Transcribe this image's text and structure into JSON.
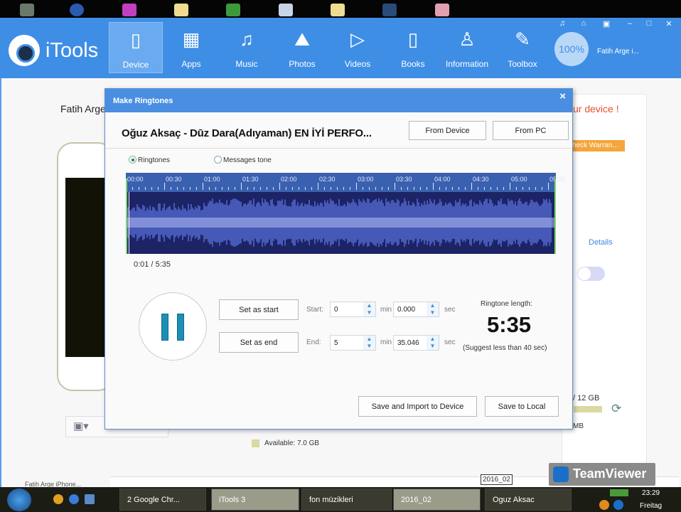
{
  "header": {
    "app_name": "iTools",
    "battery": "100%",
    "user": "Fatih Arge i...",
    "nav": [
      {
        "label": "Device",
        "icon": "phone-icon"
      },
      {
        "label": "Apps",
        "icon": "apps-icon"
      },
      {
        "label": "Music",
        "icon": "music-icon"
      },
      {
        "label": "Photos",
        "icon": "photo-icon"
      },
      {
        "label": "Videos",
        "icon": "video-icon"
      },
      {
        "label": "Books",
        "icon": "book-icon"
      },
      {
        "label": "Information",
        "icon": "user-icon"
      },
      {
        "label": "Toolbox",
        "icon": "wrench-icon"
      }
    ]
  },
  "background": {
    "device_name": "Fatih Arge",
    "alert": "ur device !",
    "warranty": "heck  Warran...",
    "details": "Details",
    "storage": "/ 12 GB",
    "mb": "MB",
    "available": "Available: 7.0 GB",
    "status_device": "Fatih Arge iPhone..."
  },
  "dialog": {
    "title": "Make Ringtones",
    "close": "×",
    "song": "Oğuz Aksaç - Dūz Dara(Adıyaman) EN İYİ PERFO...",
    "from_device": "From Device",
    "from_pc": "From PC",
    "radio_ringtones": "Ringtones",
    "radio_messages": "Messages tone",
    "time_labels": [
      "00:00",
      "00:30",
      "01:00",
      "01:30",
      "02:00",
      "02:30",
      "03:00",
      "03:30",
      "04:00",
      "04:30",
      "05:00",
      "05:30"
    ],
    "position": "0:01 / 5:35",
    "playback_progress": 0.003,
    "set_start": "Set as start",
    "set_end": "Set as end",
    "start_label": "Start:",
    "end_label": "End:",
    "min": "min",
    "sec": "sec",
    "start_min": "0",
    "start_sec": "0.000",
    "end_min": "5",
    "end_sec": "35.046",
    "length_label": "Ringtone length:",
    "length": "5:35",
    "suggest": "(Suggest less than 40 sec)",
    "save_import": "Save and Import to Device",
    "save_local": "Save to Local"
  },
  "overlay": {
    "teamviewer": "TeamViewer",
    "tooltip": "2016_02"
  },
  "taskbar": {
    "items": [
      "2 Google Chr...",
      "iTools 3",
      "fon müzikleri",
      "2016_02",
      "Oguz Aksac"
    ],
    "time": "23:29",
    "day": "Freitag"
  }
}
